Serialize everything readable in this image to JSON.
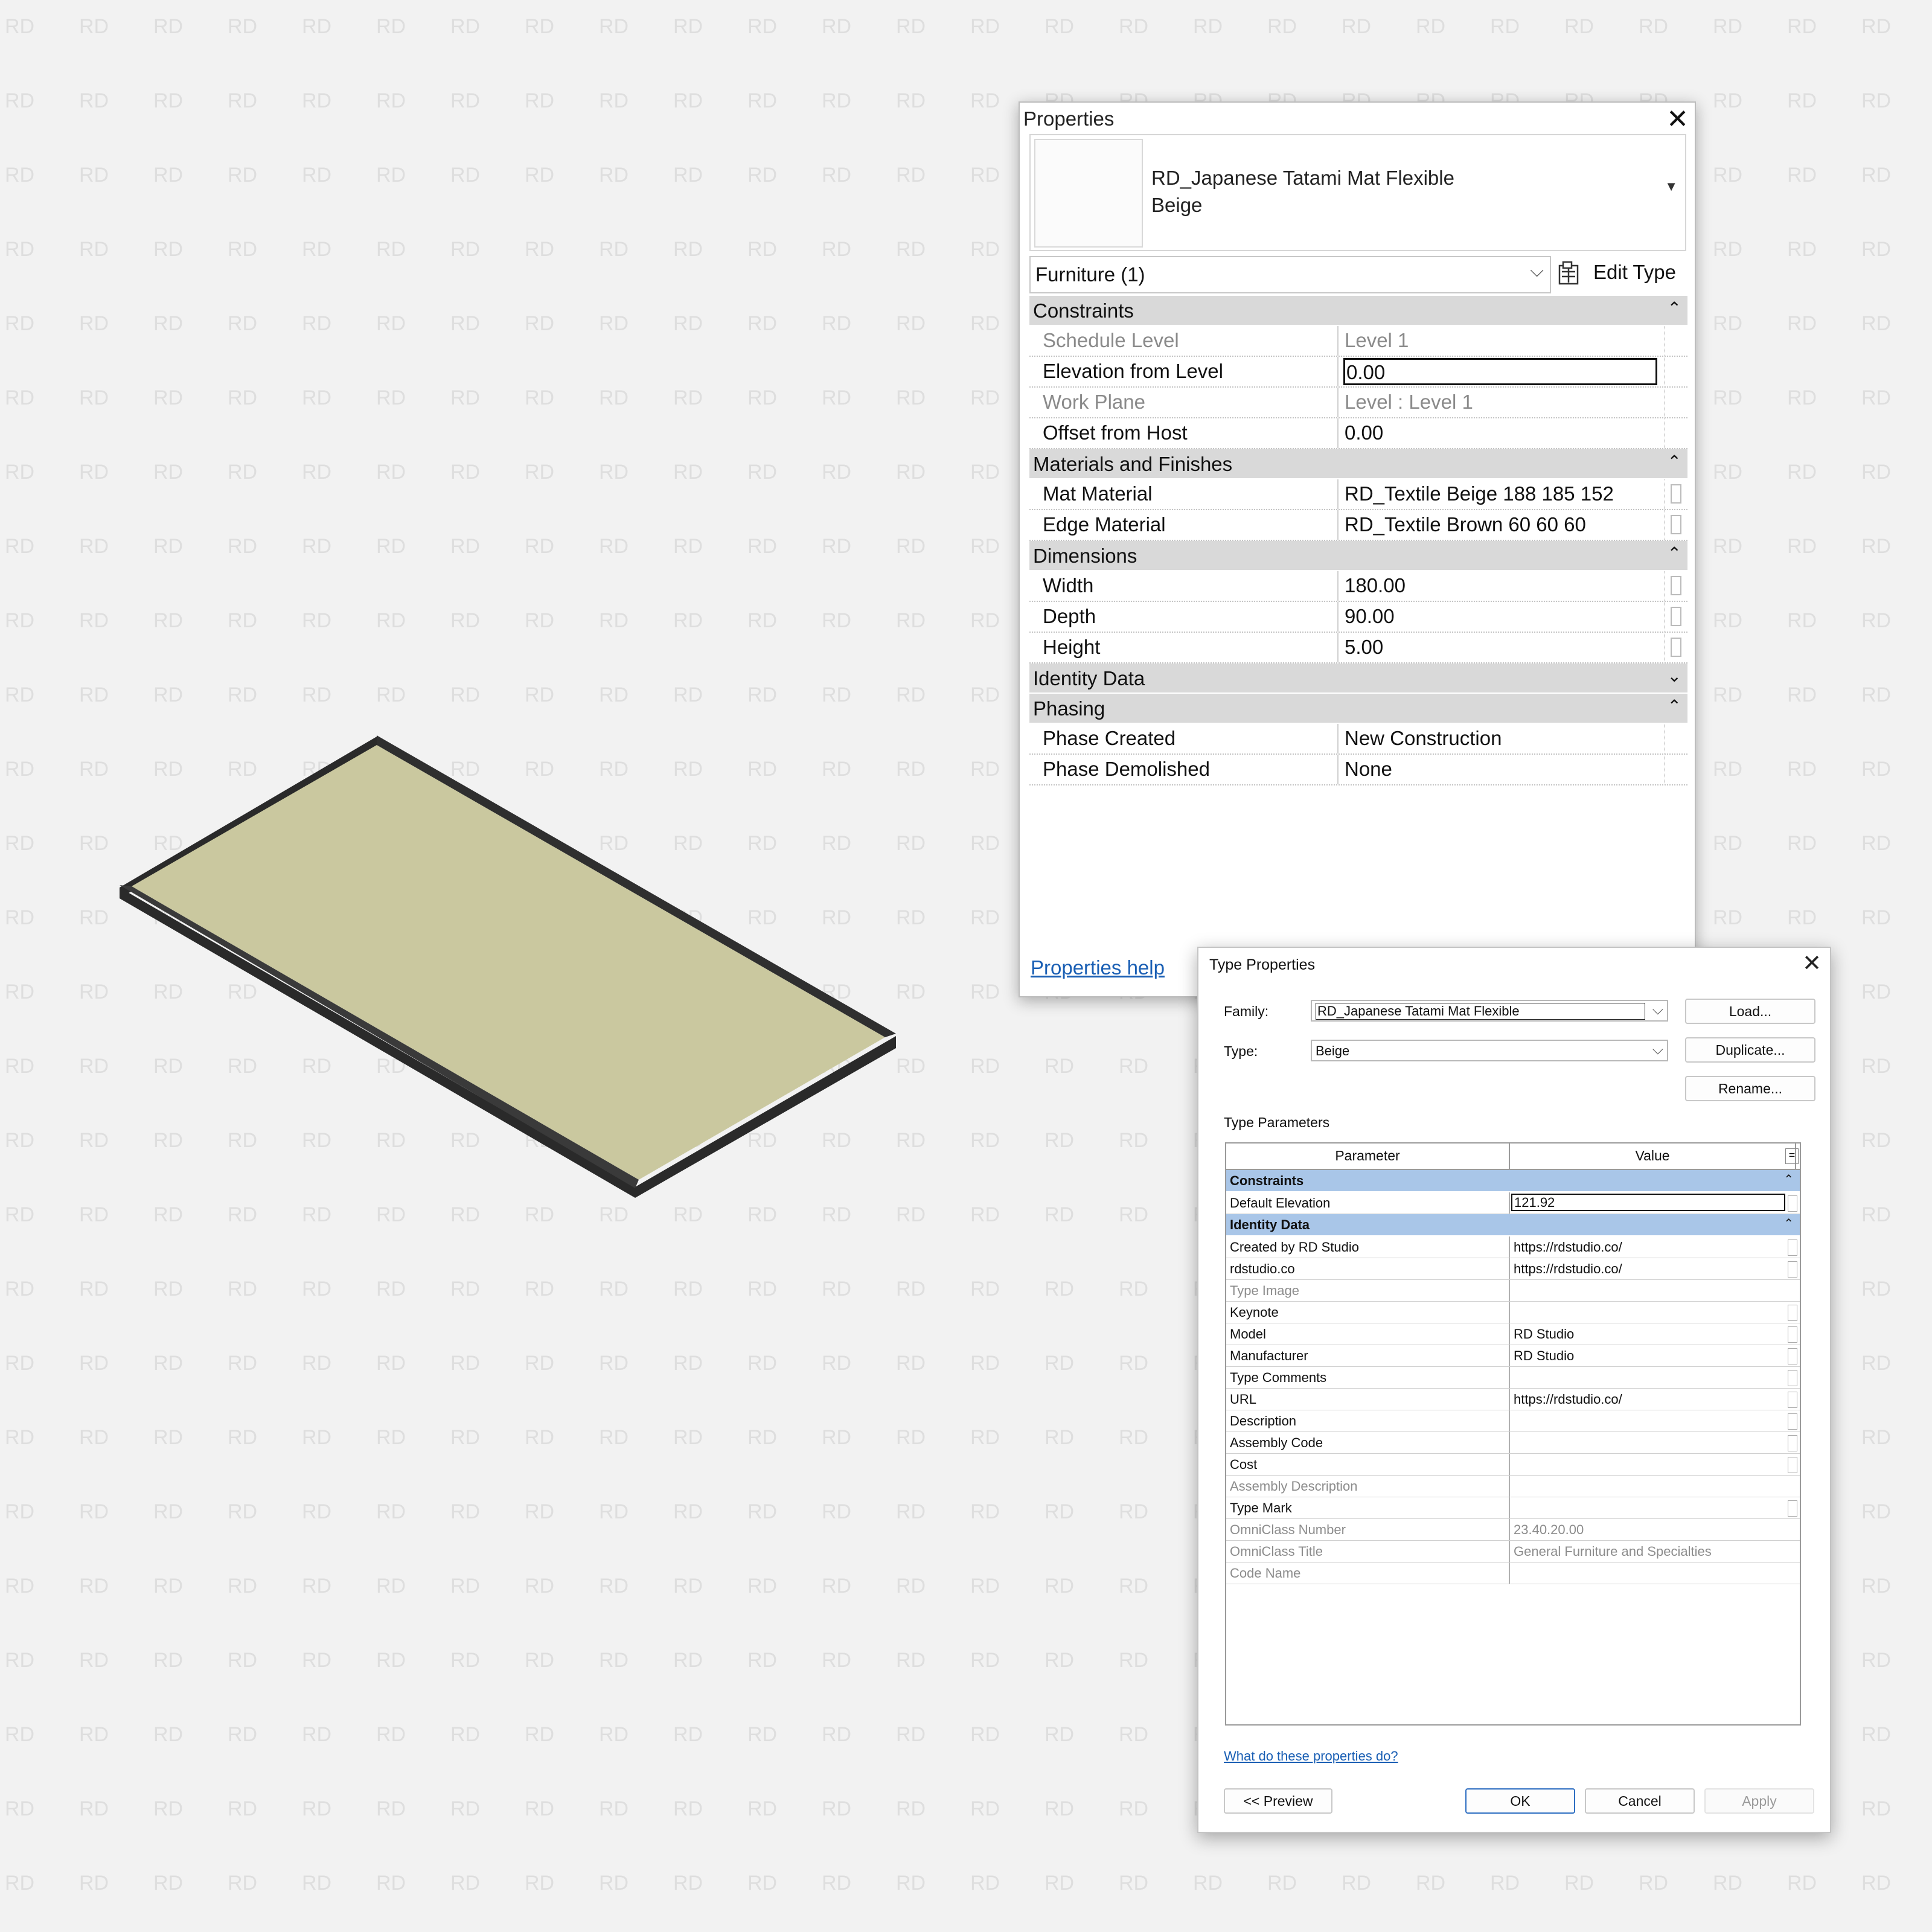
{
  "watermark": "RD",
  "colors": {
    "mat_surface": "#cac89f",
    "mat_edge": "#2a2a2a",
    "category_header": "#d9d9d9",
    "type_category_header": "#a9c6e8",
    "link": "#1a5fb4"
  },
  "properties": {
    "title": "Properties",
    "close_icon": "close-icon",
    "type_selector": {
      "family": "RD_Japanese Tatami Mat Flexible",
      "type": "Beige"
    },
    "instance_filter": "Furniture (1)",
    "edit_type_label": "Edit Type",
    "groups": [
      {
        "label": "Constraints",
        "expanded": true,
        "rows": [
          {
            "name": "Schedule Level",
            "value": "Level 1",
            "disabled": true
          },
          {
            "name": "Elevation from Level",
            "value": "0.00",
            "focused": true
          },
          {
            "name": "Work Plane",
            "value": "Level : Level 1",
            "disabled": true
          },
          {
            "name": "Offset from Host",
            "value": "0.00"
          }
        ]
      },
      {
        "label": "Materials and Finishes",
        "expanded": true,
        "rows": [
          {
            "name": "Mat Material",
            "value": "RD_Textile Beige 188 185 152",
            "assoc": true
          },
          {
            "name": "Edge Material",
            "value": "RD_Textile Brown 60 60 60",
            "assoc": true
          }
        ]
      },
      {
        "label": "Dimensions",
        "expanded": true,
        "rows": [
          {
            "name": "Width",
            "value": "180.00",
            "assoc": true
          },
          {
            "name": "Depth",
            "value": "90.00",
            "assoc": true
          },
          {
            "name": "Height",
            "value": "5.00",
            "assoc": true
          }
        ]
      },
      {
        "label": "Identity Data",
        "expanded": false,
        "rows": []
      },
      {
        "label": "Phasing",
        "expanded": true,
        "rows": [
          {
            "name": "Phase Created",
            "value": "New Construction"
          },
          {
            "name": "Phase Demolished",
            "value": "None"
          }
        ]
      }
    ],
    "help_link": "Properties help"
  },
  "type_properties": {
    "title": "Type Properties",
    "family_label": "Family:",
    "family_value": "RD_Japanese Tatami Mat Flexible",
    "type_label": "Type:",
    "type_value": "Beige",
    "buttons": {
      "load": "Load...",
      "duplicate": "Duplicate...",
      "rename": "Rename..."
    },
    "type_parameters_label": "Type Parameters",
    "columns": {
      "parameter": "Parameter",
      "value": "Value",
      "sort": "="
    },
    "groups": [
      {
        "label": "Constraints",
        "rows": [
          {
            "name": "Default Elevation",
            "value": "121.92",
            "focused": true,
            "assoc": true
          }
        ]
      },
      {
        "label": "Identity Data",
        "rows": [
          {
            "name": "Created by RD Studio",
            "value": "https://rdstudio.co/",
            "assoc": true
          },
          {
            "name": "rdstudio.co",
            "value": "https://rdstudio.co/",
            "assoc": true
          },
          {
            "name": "Type Image",
            "value": "",
            "disabled": true
          },
          {
            "name": "Keynote",
            "value": "",
            "assoc": true
          },
          {
            "name": "Model",
            "value": "RD Studio",
            "assoc": true
          },
          {
            "name": "Manufacturer",
            "value": "RD Studio",
            "assoc": true
          },
          {
            "name": "Type Comments",
            "value": "",
            "assoc": true
          },
          {
            "name": "URL",
            "value": "https://rdstudio.co/",
            "assoc": true
          },
          {
            "name": "Description",
            "value": "",
            "assoc": true
          },
          {
            "name": "Assembly Code",
            "value": "",
            "assoc": true
          },
          {
            "name": "Cost",
            "value": "",
            "assoc": true
          },
          {
            "name": "Assembly Description",
            "value": "",
            "disabled": true
          },
          {
            "name": "Type Mark",
            "value": "",
            "assoc": true
          },
          {
            "name": "OmniClass Number",
            "value": "23.40.20.00",
            "disabled": true
          },
          {
            "name": "OmniClass Title",
            "value": "General Furniture and Specialties",
            "disabled": true
          },
          {
            "name": "Code Name",
            "value": "",
            "disabled": true
          }
        ]
      }
    ],
    "help_link": "What do these properties do?",
    "footer": {
      "preview": "<< Preview",
      "ok": "OK",
      "cancel": "Cancel",
      "apply": "Apply"
    }
  }
}
